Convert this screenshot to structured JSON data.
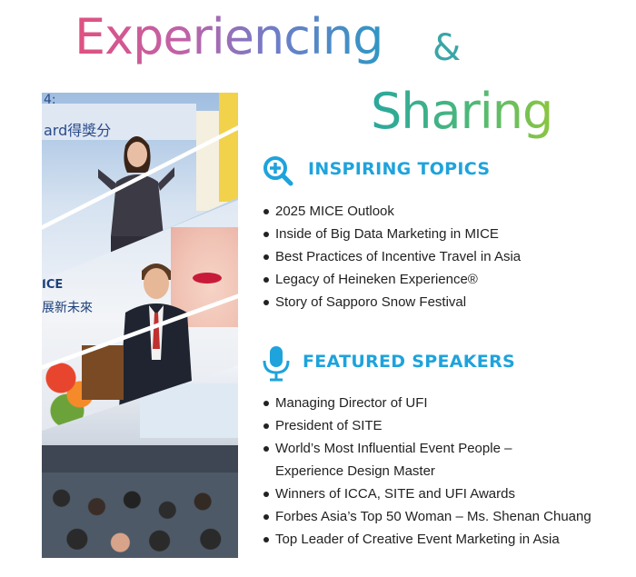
{
  "header": {
    "title_line1": "Experiencing",
    "ampersand": "&",
    "title_line2": "Sharing"
  },
  "collage": {
    "panel1_screen_text": "ard得獎分",
    "panel1_corner_text": "4:",
    "panel2_screen_text": "展新未來",
    "panel2_mice_text": "ICE"
  },
  "sections": [
    {
      "title": "INSPIRING TOPICS",
      "icon": "magnifier-plus-icon",
      "items": [
        "2025 MICE Outlook",
        "Inside of Big Data Marketing in MICE",
        "Best Practices of Incentive Travel in Asia",
        "Legacy of Heineken Experience®",
        "Story of Sapporo Snow Festival"
      ]
    },
    {
      "title": "FEATURED SPEAKERS",
      "icon": "microphone-icon",
      "items": [
        "Managing Director of UFI",
        "President of SITE",
        "World’s Most Influential Event People –",
        "Experience Design Master",
        "Winners of ICCA, SITE and UFI Awards",
        "Forbes Asia’s Top 50 Woman – Ms. Shenan Chuang",
        "Top Leader of Creative Event Marketing in Asia"
      ]
    }
  ],
  "colors": {
    "section_title": "#1ea3dc",
    "title_gradient_1": [
      "#e0507f",
      "#c062a8",
      "#6e7dc8",
      "#2f97c4"
    ],
    "title_gradient_2": [
      "#2aa79e",
      "#4cb87a",
      "#8cc63f"
    ]
  }
}
